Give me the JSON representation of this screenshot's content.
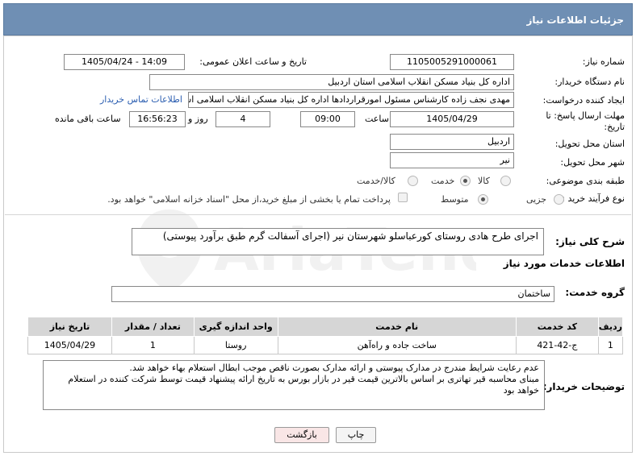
{
  "header": {
    "title": "جزئیات اطلاعات نیاز"
  },
  "form": {
    "need_number": {
      "label": "شماره نیاز:",
      "value": "1105005291000061"
    },
    "announce": {
      "label": "تاریخ و ساعت اعلان عمومی:",
      "value": "1405/04/24 - 14:09"
    },
    "buyer_org": {
      "label": "نام دستگاه خریدار:",
      "value": "اداره کل بنیاد مسکن انقلاب اسلامی استان اردبیل"
    },
    "requester": {
      "label": "ایجاد کننده درخواست:",
      "value": "مهدی نجف زاده کارشناس مسئول امورقراردادها اداره کل بنیاد مسکن انقلاب اسلامی استان اردبیل",
      "contact_link": "اطلاعات تماس خریدار"
    },
    "deadline": {
      "label": "مهلت ارسال پاسخ: تا تاریخ:",
      "date": "1405/04/29",
      "time_label": "ساعت",
      "time": "09:00",
      "days": "4",
      "days_label": "روز و",
      "remaining": "16:56:23",
      "remaining_label": "ساعت باقی مانده"
    },
    "province": {
      "label": "استان محل تحویل:",
      "value": "اردبیل"
    },
    "city": {
      "label": "شهر محل تحویل:",
      "value": "نیر"
    },
    "category": {
      "label": "طبقه بندی موضوعی:",
      "options": [
        "کالا",
        "خدمت",
        "کالا/خدمت"
      ],
      "selected": "خدمت"
    },
    "purchase_type": {
      "label": "نوع فرآیند خرید :",
      "options": [
        "جزیی",
        "متوسط"
      ],
      "selected": "متوسط",
      "payment_note": "پرداخت تمام یا بخشی از مبلغ خرید،از محل \"اسناد خزانه اسلامی\" خواهد بود."
    }
  },
  "summary": {
    "label": "شرح کلی نیاز:",
    "value": "اجرای طرح هادی روستای کورعباسلو شهرستان نیر (اجرای آسفالت گرم طبق برآورد  پیوستی)"
  },
  "services": {
    "section_title": "اطلاعات خدمات مورد نیاز",
    "group_label": "گروه خدمت:",
    "group_value": "ساختمان",
    "columns": [
      "ردیف",
      "کد خدمت",
      "نام خدمت",
      "واحد اندازه گیری",
      "تعداد / مقدار",
      "تاریخ نیاز"
    ],
    "rows": [
      {
        "row": "1",
        "code": "ج-42-421",
        "name": "ساخت جاده و راه‌آهن",
        "unit": "روستا",
        "qty": "1",
        "date": "1405/04/29"
      }
    ]
  },
  "buyer_notes": {
    "label": "توضیحات خریدار:",
    "value": "عدم رعایت شرایط مندرج در مدارک پیوستی و ارائه مدارک بصورت ناقص موجب ابطال استعلام بهاء خواهد شد.\nمبنای محاسبه قیر تهاتری بر اساس بالاترین قیمت قیر در بازار بورس به تاریخ ارائه پیشنهاد قیمت توسط شرکت کننده در استعلام خواهد بود"
  },
  "buttons": {
    "print": "چاپ",
    "back": "بازگشت"
  },
  "watermark_text": "AriaTender.net",
  "colors": {
    "header_bg": "#6f8fb4",
    "link": "#2a5db0",
    "table_header": "#d6d6d6"
  }
}
